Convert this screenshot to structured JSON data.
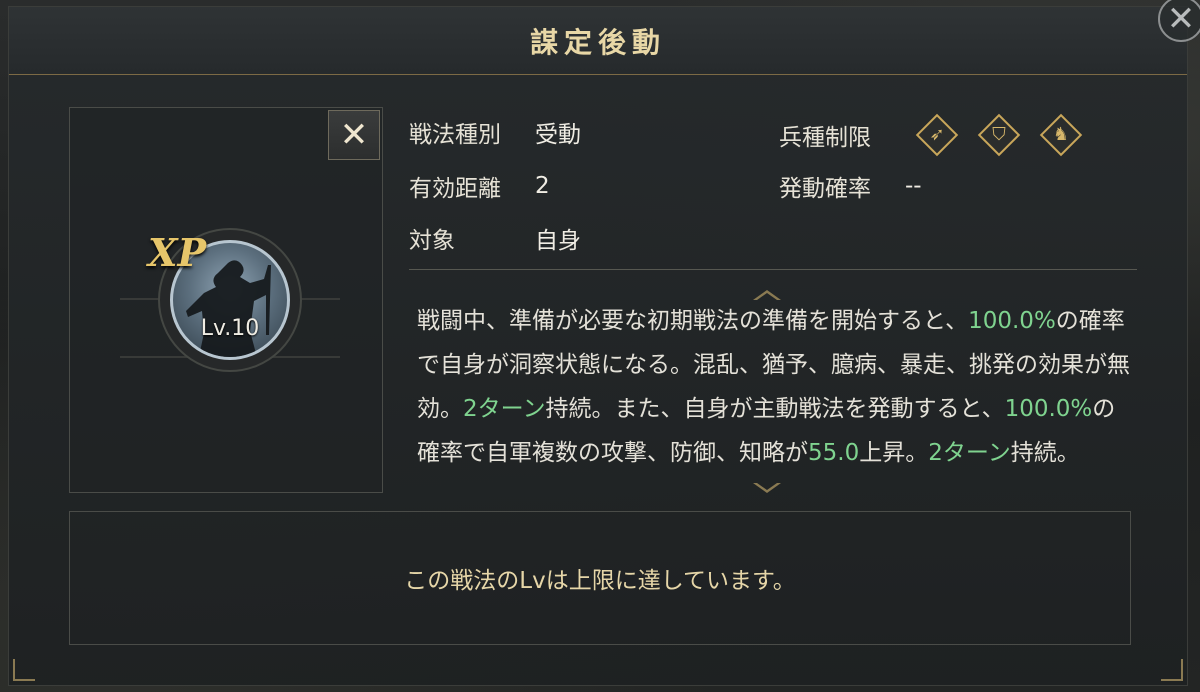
{
  "dialog": {
    "title": "謀定後動"
  },
  "skill": {
    "badge": "XP",
    "level": "Lv.10"
  },
  "info": {
    "type_label": "戦法種別",
    "type_value": "受動",
    "range_label": "有効距離",
    "range_value": "2",
    "target_label": "対象",
    "target_value": "自身",
    "troop_label": "兵種制限",
    "troop_icons": [
      "bow-icon",
      "shield-icon",
      "horse-icon"
    ],
    "rate_label": "発動確率",
    "rate_value": "--"
  },
  "description": {
    "segments": [
      {
        "text": "戦闘中、準備が必要な初期戦法の準備を開始すると、",
        "hl": false
      },
      {
        "text": "100.0%",
        "hl": true
      },
      {
        "text": "の確率で自身が洞察状態になる。混乱、猶予、臆病、暴走、挑発の効果が無効。",
        "hl": false
      },
      {
        "text": "2ターン",
        "hl": true
      },
      {
        "text": "持続。また、自身が主動戦法を発動すると、",
        "hl": false
      },
      {
        "text": "100.0%",
        "hl": true
      },
      {
        "text": "の確率で自軍複数の攻撃、防御、知略が",
        "hl": false
      },
      {
        "text": "55.0",
        "hl": true
      },
      {
        "text": "上昇。",
        "hl": false
      },
      {
        "text": "2ターン",
        "hl": true
      },
      {
        "text": "持続。",
        "hl": false
      }
    ]
  },
  "footer": {
    "message": "この戦法のLvは上限に達しています。"
  },
  "colors": {
    "highlight": "#7fd38f",
    "gold": "#e8d7a6"
  }
}
